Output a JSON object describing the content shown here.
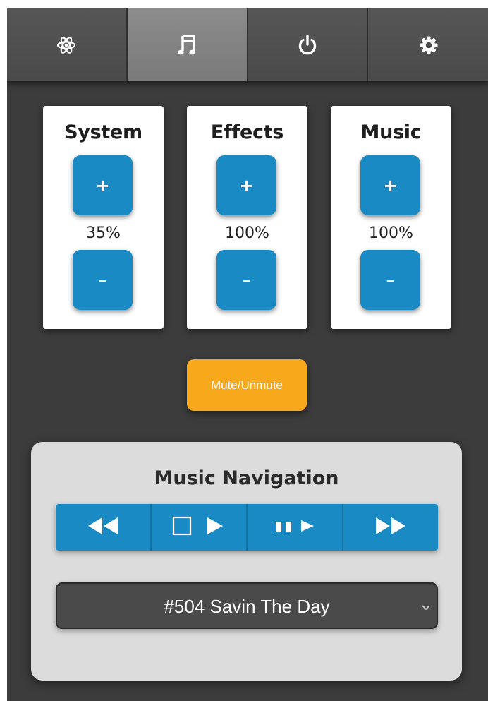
{
  "tabs": [
    {
      "name": "atom-icon",
      "active": false
    },
    {
      "name": "music-note-icon",
      "active": true
    },
    {
      "name": "power-icon",
      "active": false
    },
    {
      "name": "gear-icon",
      "active": false
    }
  ],
  "volume": {
    "system": {
      "title": "System",
      "plus": "+",
      "value": "35%",
      "minus": "–"
    },
    "effects": {
      "title": "Effects",
      "plus": "+",
      "value": "100%",
      "minus": "–"
    },
    "music": {
      "title": "Music",
      "plus": "+",
      "value": "100%",
      "minus": "–"
    }
  },
  "mute_label": "Mute/Unmute",
  "navigation": {
    "title": "Music Navigation",
    "controls": [
      "rewind-icon",
      "stop-play-icon",
      "pause-play-icon",
      "fast-forward-icon"
    ],
    "selected_track": "#504 Savin The Day"
  },
  "colors": {
    "background": "#3c3c3c",
    "accent_blue": "#1a8ac5",
    "mute_orange": "#f7a81b",
    "active_tab": "#808080"
  }
}
